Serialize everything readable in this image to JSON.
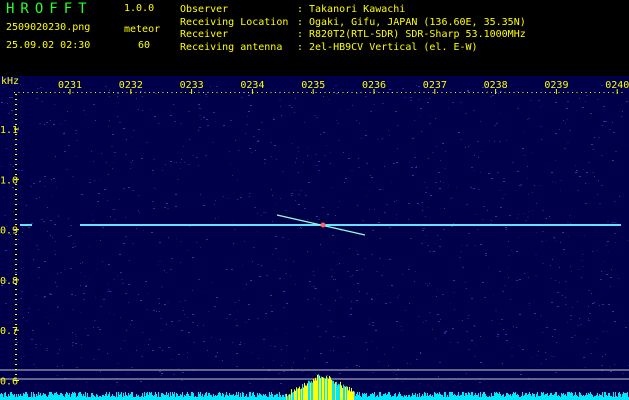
{
  "header": {
    "app_title": "HROFFT",
    "version": "1.0.0",
    "file_name": "2509020230.png",
    "timestamp": "25.09.02 02:30",
    "mode_label": "meteor",
    "mode_value": "60",
    "info": [
      {
        "key": "Observer",
        "sep": ":",
        "value": "Takanori Kawachi"
      },
      {
        "key": "Receiving Location",
        "sep": ":",
        "value": "Ogaki, Gifu, JAPAN (136.60E, 35.35N)"
      },
      {
        "key": "Receiver",
        "sep": ":",
        "value": "R820T2(RTL-SDR) SDR-Sharp 53.1000MHz"
      },
      {
        "key": "Receiving antenna",
        "sep": ":",
        "value": "2el-HB9CV Vertical (el. E-W)"
      }
    ]
  },
  "spectrogram": {
    "unit_label": "kHz",
    "y_ticks": [
      "1.1",
      "1.0",
      "0.9",
      "0.8",
      "0.7",
      "0.6"
    ],
    "x_ticks": [
      "0231",
      "0232",
      "0233",
      "0234",
      "0235",
      "0236",
      "0237",
      "0238",
      "0239",
      "0240"
    ],
    "colors": {
      "background": "#00004a",
      "label": "#ffff00",
      "tick": "#ffff00",
      "carrier": "#68e0ff",
      "meteor_trail": "#90ffe0",
      "meteor_head": "#ff6060",
      "level_bars": "#00e8ff",
      "level_peak": "#ffff00",
      "reference_line": "#c8c8c8"
    }
  }
}
